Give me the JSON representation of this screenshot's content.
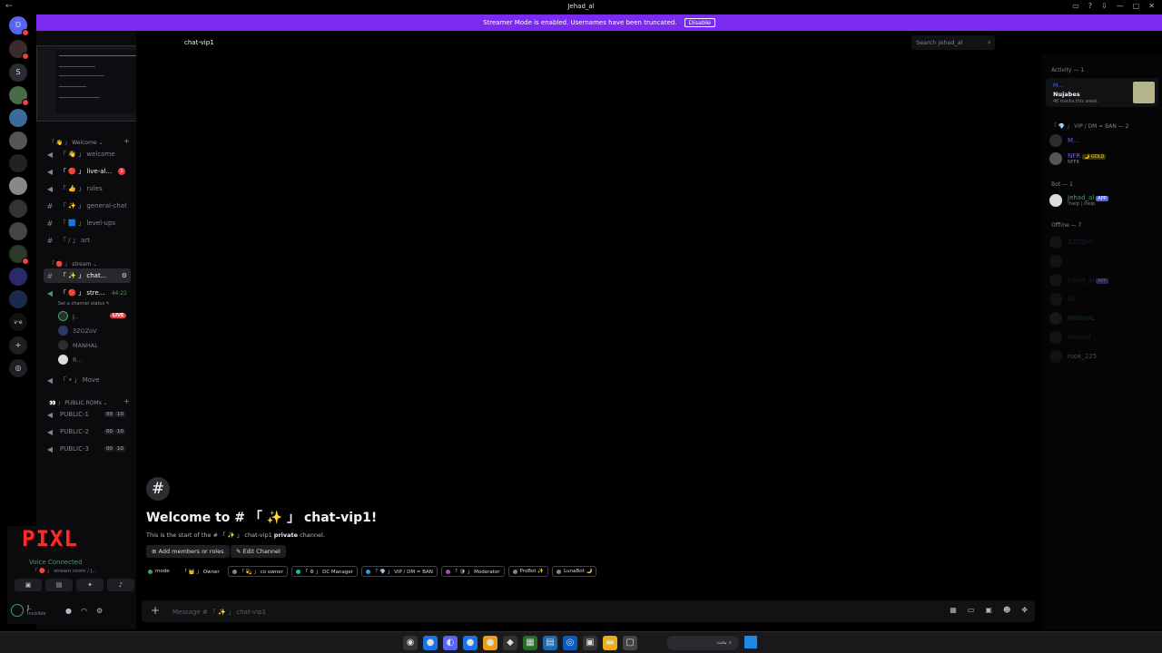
{
  "window": {
    "title": "Jehad_al"
  },
  "banner": {
    "text": "Streamer Mode is enabled. Usernames have been truncated.",
    "button": "Disable"
  },
  "servers": [
    "D",
    "S",
    "v·e"
  ],
  "sidebar": {
    "categories": {
      "welcome": "「 👋 」 Welcome ⌄",
      "stream": "「 🔴 」 stream ⌄",
      "public": "👀 」 PUBLIC ROMs ⌄"
    },
    "channels": [
      {
        "label": "「 👋 」 welcome"
      },
      {
        "label": "「 🔴 」 live-al...",
        "badge": "1"
      },
      {
        "label": "「 👍 」 rules"
      },
      {
        "label": "「 ✨ 」 general-chat"
      },
      {
        "label": "「 🟦 」 level-ups"
      },
      {
        "label": "「 ∕ 」 art"
      },
      {
        "label": "「 ✨ 」 chat..."
      },
      {
        "label": "「 🔴 」 stre...",
        "time": "44:22"
      },
      {
        "label": "「 • 」 Move"
      },
      {
        "label": "PUBLIC-1",
        "cnt1": "00",
        "cnt2": "10"
      },
      {
        "label": "PUBLIC-2",
        "cnt1": "00",
        "cnt2": "10"
      },
      {
        "label": "PUBLIC-3",
        "cnt1": "00",
        "cnt2": "10"
      }
    ],
    "channel_status": "Set a channel status ✎",
    "voice_members": [
      "J..",
      "3ZOZoV",
      "MANHAL",
      "R..."
    ],
    "live": "LIVE",
    "voice_panel": {
      "logo": "PIXL",
      "status": "Voice Connected",
      "sub": "「 🔴 」 stream room / J...",
      "username": "J.",
      "user_status": "Invisible"
    }
  },
  "main": {
    "channel_name": "chat-vip1",
    "search_placeholder": "Search Jehad_al",
    "welcome_title": "Welcome to # 「 ✨ 」 chat-vip1!",
    "welcome_sub_prefix": "This is the start of the # 「 ✨ 」 chat-vip1 ",
    "welcome_sub_bold": "private",
    "welcome_sub_suffix": " channel.",
    "add_members": "Add members or roles",
    "edit_channel": "Edit Channel",
    "roles": [
      "mode",
      "「 👑 」 Owner",
      "「 💫 」 co owner",
      "「 ⚙ 」 DC Manager",
      "「 💎 」 VIP / DM = BAN",
      "「 🛡 」 Moderator",
      "ProBot ✨",
      "LunaBot 🌙"
    ],
    "composer_placeholder": "Message # 「 ✨ 」 chat-vip1"
  },
  "members": {
    "activity_header": "Activity — 1",
    "activity": {
      "title": "M...",
      "name": "Nujabes",
      "sub": "46 tracks this week"
    },
    "vip_header": "「 💎 」 VIP / DM = BAN — 2",
    "vip": [
      {
        "name": "M..."
      },
      {
        "name": "NFR",
        "tag": "🌙 GOLD",
        "sub": "NFFR"
      }
    ],
    "bot_header": "Bot — 1",
    "bot": {
      "name": "Jehad_al",
      "tag": "APP",
      "sub": "!help | /help"
    },
    "offline_header": "Offline — 7",
    "offline": [
      "3ZOZoV",
      "",
      "Jehad_al",
      "Ali",
      "MANHAL",
      "Mayoof",
      "rook_225"
    ],
    "offline_app_tag": "APP"
  },
  "taskbar": {
    "search": "بحث"
  },
  "colors": {
    "accent": "#5865f2",
    "banner": "#7b2bef",
    "online": "#3ba55d",
    "danger": "#f23f43"
  }
}
